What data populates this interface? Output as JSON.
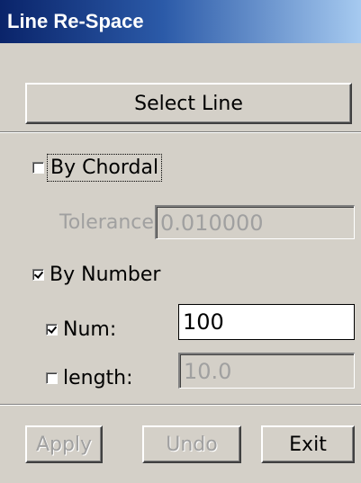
{
  "window": {
    "title": "Line Re-Space"
  },
  "select_button": "Select Line",
  "by_chordal": {
    "label": "By Chordal",
    "checked": false
  },
  "tolerance": {
    "label": "Tolerance:",
    "value": "0.010000",
    "enabled": false
  },
  "by_number": {
    "label": "By Number",
    "checked": true
  },
  "num": {
    "label": "Num:",
    "checked": true,
    "value": "100"
  },
  "length": {
    "label": "length:",
    "checked": false,
    "value": "10.0"
  },
  "buttons": {
    "apply": "Apply",
    "undo": "Undo",
    "exit": "Exit"
  }
}
